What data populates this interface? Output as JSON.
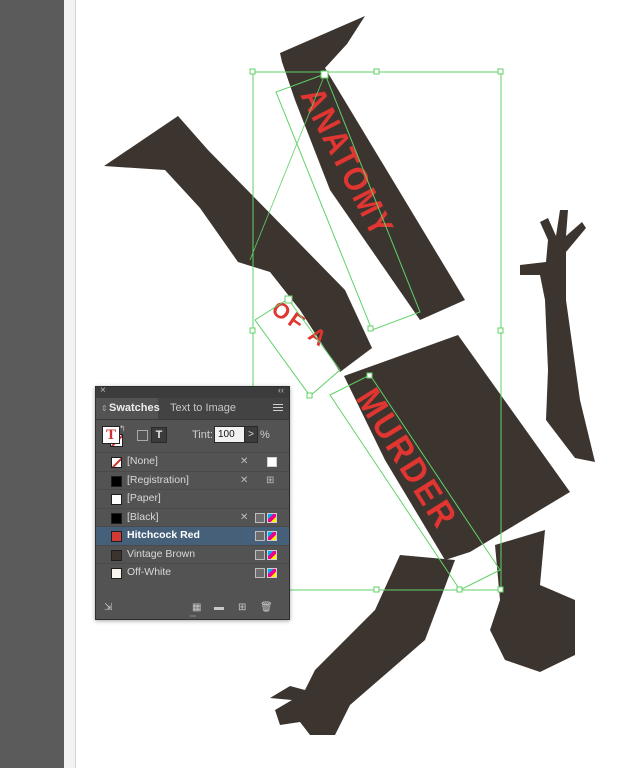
{
  "colors": {
    "pasteboard": "#5b5b5b",
    "silhouette": "#3c352f",
    "title_red": "#e03530",
    "frame_green": "#5fd167",
    "panel_bg": "#535353",
    "selected_row": "#47607a"
  },
  "artwork": {
    "title_words": [
      "ANATOMY",
      "OF A",
      "MURDER"
    ]
  },
  "panel": {
    "tabs": [
      {
        "label": "Swatches",
        "active": true
      },
      {
        "label": "Text to Image",
        "active": false
      }
    ],
    "tint": {
      "label": "Tint:",
      "value": "100",
      "unit": "%"
    },
    "swatches": [
      {
        "name": "[None]",
        "color": "none",
        "selected": false
      },
      {
        "name": "[Registration]",
        "color": "#000000",
        "selected": false
      },
      {
        "name": "[Paper]",
        "color": "#ffffff",
        "selected": false
      },
      {
        "name": "[Black]",
        "color": "#000000",
        "selected": false
      },
      {
        "name": "Hitchcock Red",
        "color": "#d33a33",
        "selected": true
      },
      {
        "name": "Vintage Brown",
        "color": "#3a332e",
        "selected": false
      },
      {
        "name": "Off-White",
        "color": "#f7f4ee",
        "selected": false
      }
    ],
    "icons": {
      "close": "close-icon",
      "collapse": "collapse-icon",
      "menu": "panel-menu-icon",
      "fill_stroke": "fill-stroke-icon",
      "new_color_group": "new-color-group-icon",
      "folder": "folder-icon",
      "new_swatch": "new-swatch-icon",
      "delete": "trash-icon",
      "show_kinds": "show-swatch-kinds-icon"
    }
  }
}
